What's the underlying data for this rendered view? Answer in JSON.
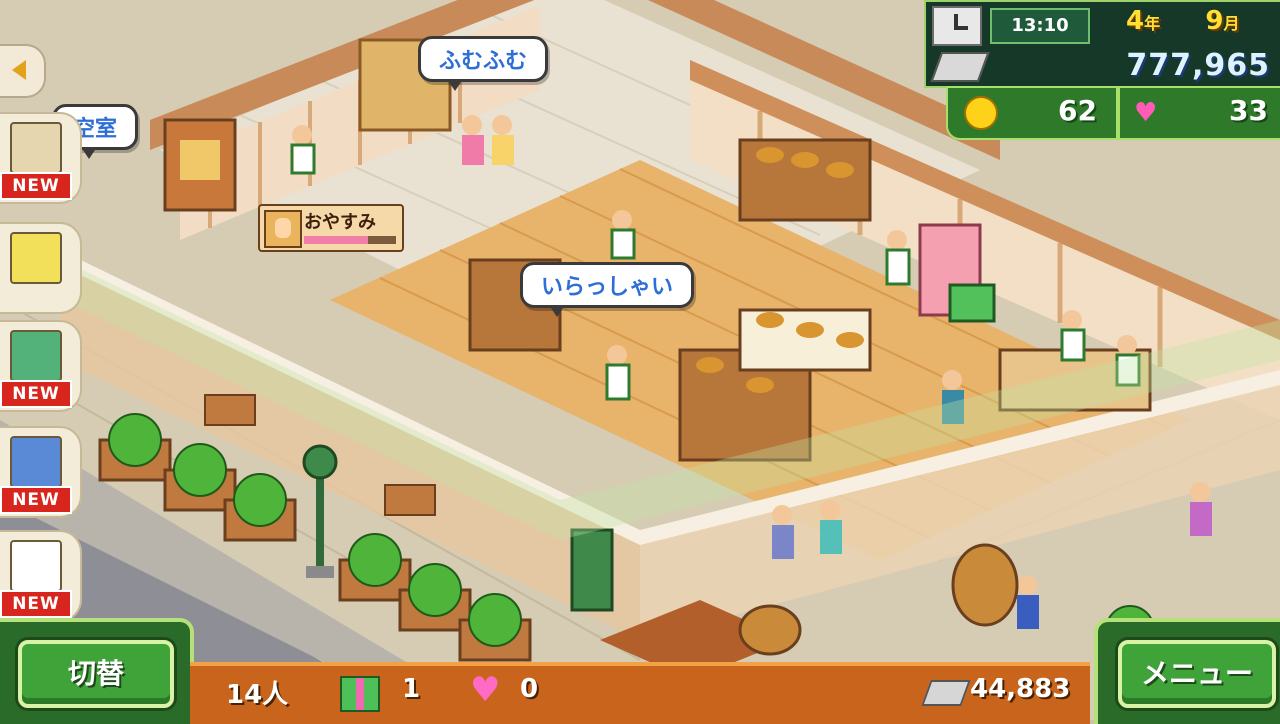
{
  "bubbles": {
    "room": "空室",
    "thinking": "ふむふむ",
    "welcome": "いらっしゃい"
  },
  "status_tag": {
    "text": "おやすみ",
    "fatigue_fraction": 0.7
  },
  "hud": {
    "time": "13:10",
    "year_num": "4",
    "year_unit": "年",
    "month_num": "9",
    "month_unit": "月",
    "money": "777,965",
    "medals": "62",
    "hearts": "33"
  },
  "sidebar": {
    "tabs": [
      {
        "icon": "bread-item-icon",
        "new": "NEW"
      },
      {
        "icon": "staff-icon",
        "new": ""
      },
      {
        "icon": "shelf-icon",
        "new": "NEW"
      },
      {
        "icon": "speech-icon",
        "new": "NEW"
      },
      {
        "icon": "screen-icon",
        "new": "NEW"
      }
    ]
  },
  "bottom": {
    "customers": "14人",
    "gifts": "1",
    "hearts": "0",
    "silver": "44,883"
  },
  "buttons": {
    "switch": "切替",
    "menu": "メニュー"
  },
  "colors": {
    "hud_green": "#163828",
    "button_green": "#3fa33a",
    "bar_orange": "#c9641c",
    "new_red": "#d8261e"
  }
}
